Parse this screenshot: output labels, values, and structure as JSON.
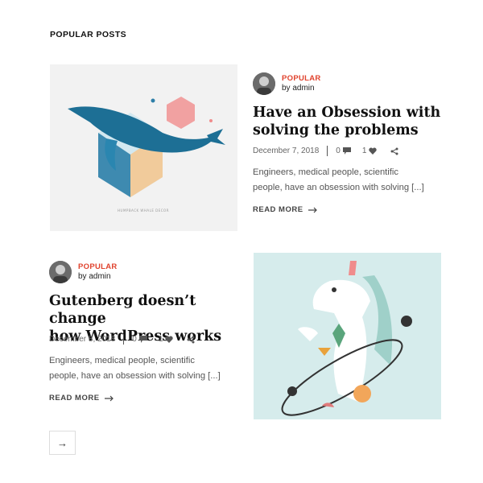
{
  "section": {
    "title": "POPULAR POSTS"
  },
  "posts": [
    {
      "category": "POPULAR",
      "author": "by admin",
      "title_line1": "Have an Obsession with",
      "title_line2": "solving the problems",
      "date": "December 7, 2018",
      "comments": "0",
      "likes": "1",
      "excerpt_line1": "Engineers, medical people, scientific",
      "excerpt_line2": "people, have an obsession with solving [...]",
      "read_more": "READ MORE",
      "image_caption": "HUMPBACK WHALE DECOR"
    },
    {
      "category": "POPULAR",
      "author": "by admin",
      "title_line1": "Gutenberg doesn’t change",
      "title_line2": "how WordPress works",
      "date": "December 8, 2018",
      "comments": "0",
      "likes": "1",
      "excerpt_line1": "Engineers, medical people, scientific",
      "excerpt_line2": "people, have an obsession with solving [...]",
      "read_more": "READ MORE"
    }
  ],
  "pagination": {
    "next_label": "→"
  },
  "colors": {
    "accent": "#e0432e",
    "text": "#111111",
    "muted": "#666666"
  },
  "icons": [
    "comment-icon",
    "heart-icon",
    "share-icon",
    "arrow-right-icon"
  ]
}
